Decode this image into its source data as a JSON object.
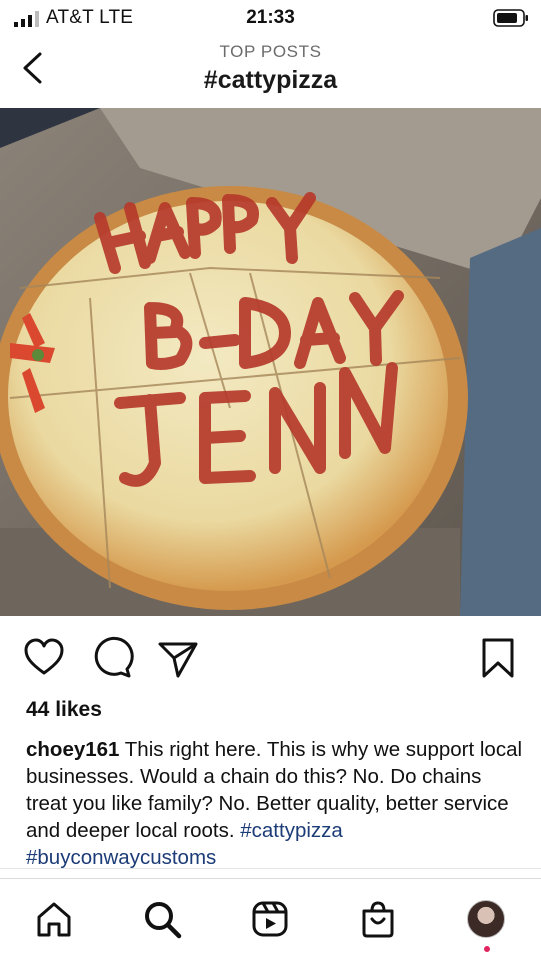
{
  "status_bar": {
    "carrier": "AT&T  LTE",
    "time": "21:33"
  },
  "header": {
    "subtitle": "TOP POSTS",
    "title": "#cattypizza"
  },
  "photo": {
    "pizza_text": [
      "HAPPY",
      "B-DAY",
      "JENN"
    ],
    "alt": "Pizza in box with HAPPY B-DAY JENN written in sauce"
  },
  "post": {
    "likes": "44 likes",
    "username": "choey161",
    "caption": " This right here. This is why we support local businesses. Would a chain do this? No. Do chains treat you like family? No. Better quality, better service and deeper local roots. ",
    "hashtags": [
      "#cattypizza",
      "#buyconwaycustoms"
    ]
  },
  "icons": {
    "back": "chevron-left-icon",
    "like": "heart-icon",
    "comment": "comment-icon",
    "share": "paper-plane-icon",
    "save": "bookmark-icon",
    "nav": [
      "home-icon",
      "search-icon",
      "reels-icon",
      "shop-icon",
      "profile-avatar"
    ]
  },
  "colors": {
    "hashtag": "#1c3c77",
    "notification": "#e0245e"
  }
}
